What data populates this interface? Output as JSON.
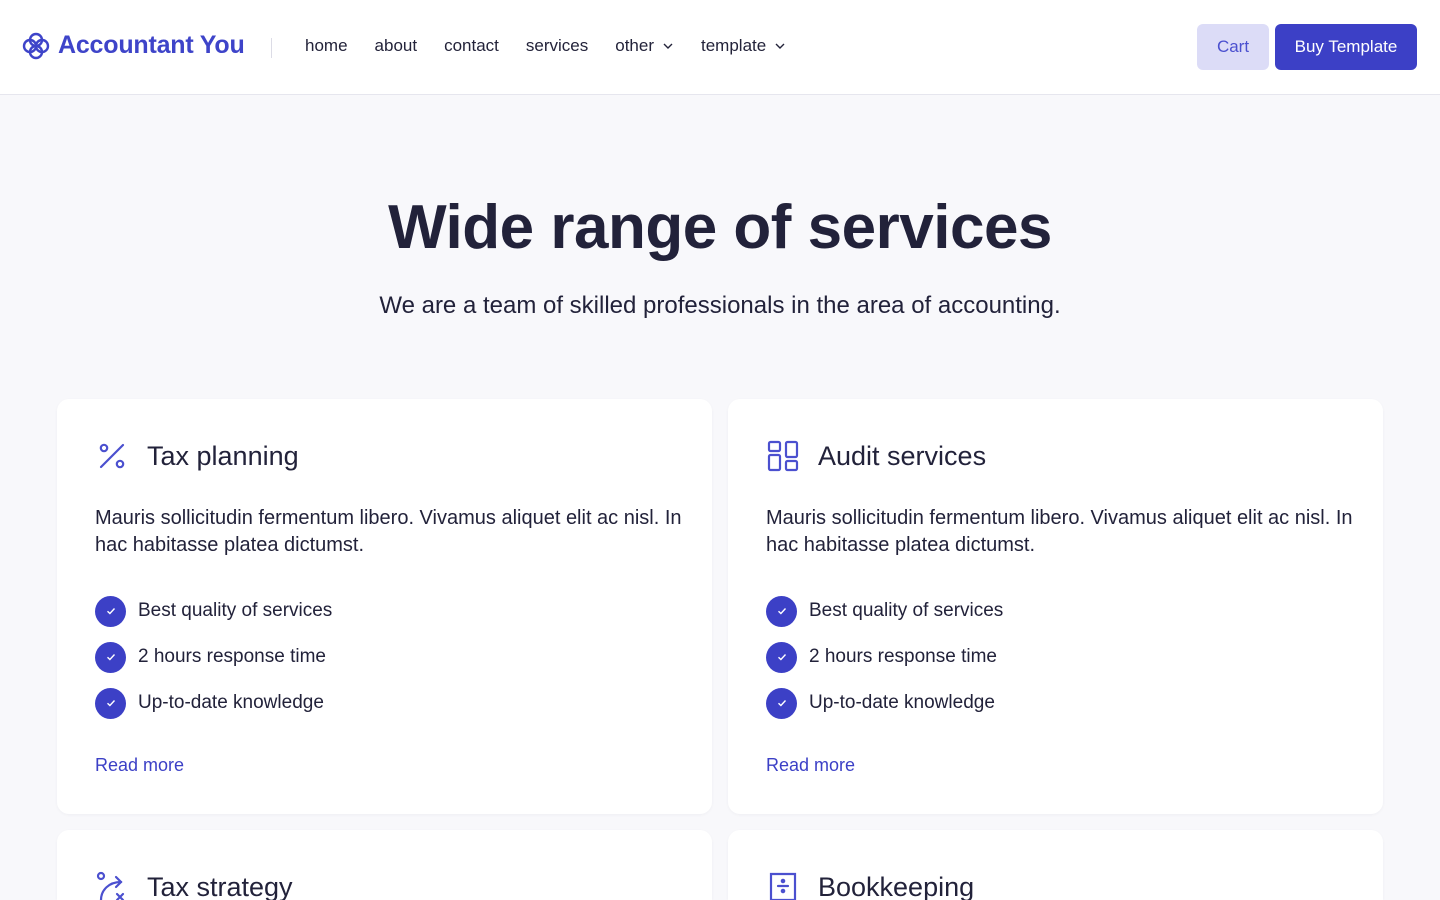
{
  "brand": {
    "name": "Accountant You",
    "icon": "flower-logo-icon"
  },
  "nav": {
    "items": [
      {
        "label": "home",
        "dropdown": false
      },
      {
        "label": "about",
        "dropdown": false
      },
      {
        "label": "contact",
        "dropdown": false
      },
      {
        "label": "services",
        "dropdown": false
      },
      {
        "label": "other",
        "dropdown": true
      },
      {
        "label": "template",
        "dropdown": true
      }
    ]
  },
  "header_buttons": {
    "cart": "Cart",
    "buy": "Buy Template"
  },
  "hero": {
    "title": "Wide range of services",
    "subtitle": "We are a team of skilled professionals in the area of accounting."
  },
  "cards": [
    {
      "title": "Tax planning",
      "icon": "percent-icon",
      "description": "Mauris sollicitudin fermentum libero. Vivamus aliquet elit ac nisl. In hac habitasse platea dictumst.",
      "features": [
        "Best quality of services",
        "2 hours response time",
        "Up-to-date knowledge"
      ],
      "link": "Read more"
    },
    {
      "title": "Audit services",
      "icon": "layout-grid-icon",
      "description": "Mauris sollicitudin fermentum libero. Vivamus aliquet elit ac nisl. In hac habitasse platea dictumst.",
      "features": [
        "Best quality of services",
        "2 hours response time",
        "Up-to-date knowledge"
      ],
      "link": "Read more"
    },
    {
      "title": "Tax strategy",
      "icon": "strategy-route-icon"
    },
    {
      "title": "Bookkeeping",
      "icon": "ledger-divide-icon"
    }
  ],
  "colors": {
    "accent": "#3c40c6",
    "accent_light": "#dcdcf7",
    "text": "#22223a",
    "background": "#f8f8fb"
  }
}
